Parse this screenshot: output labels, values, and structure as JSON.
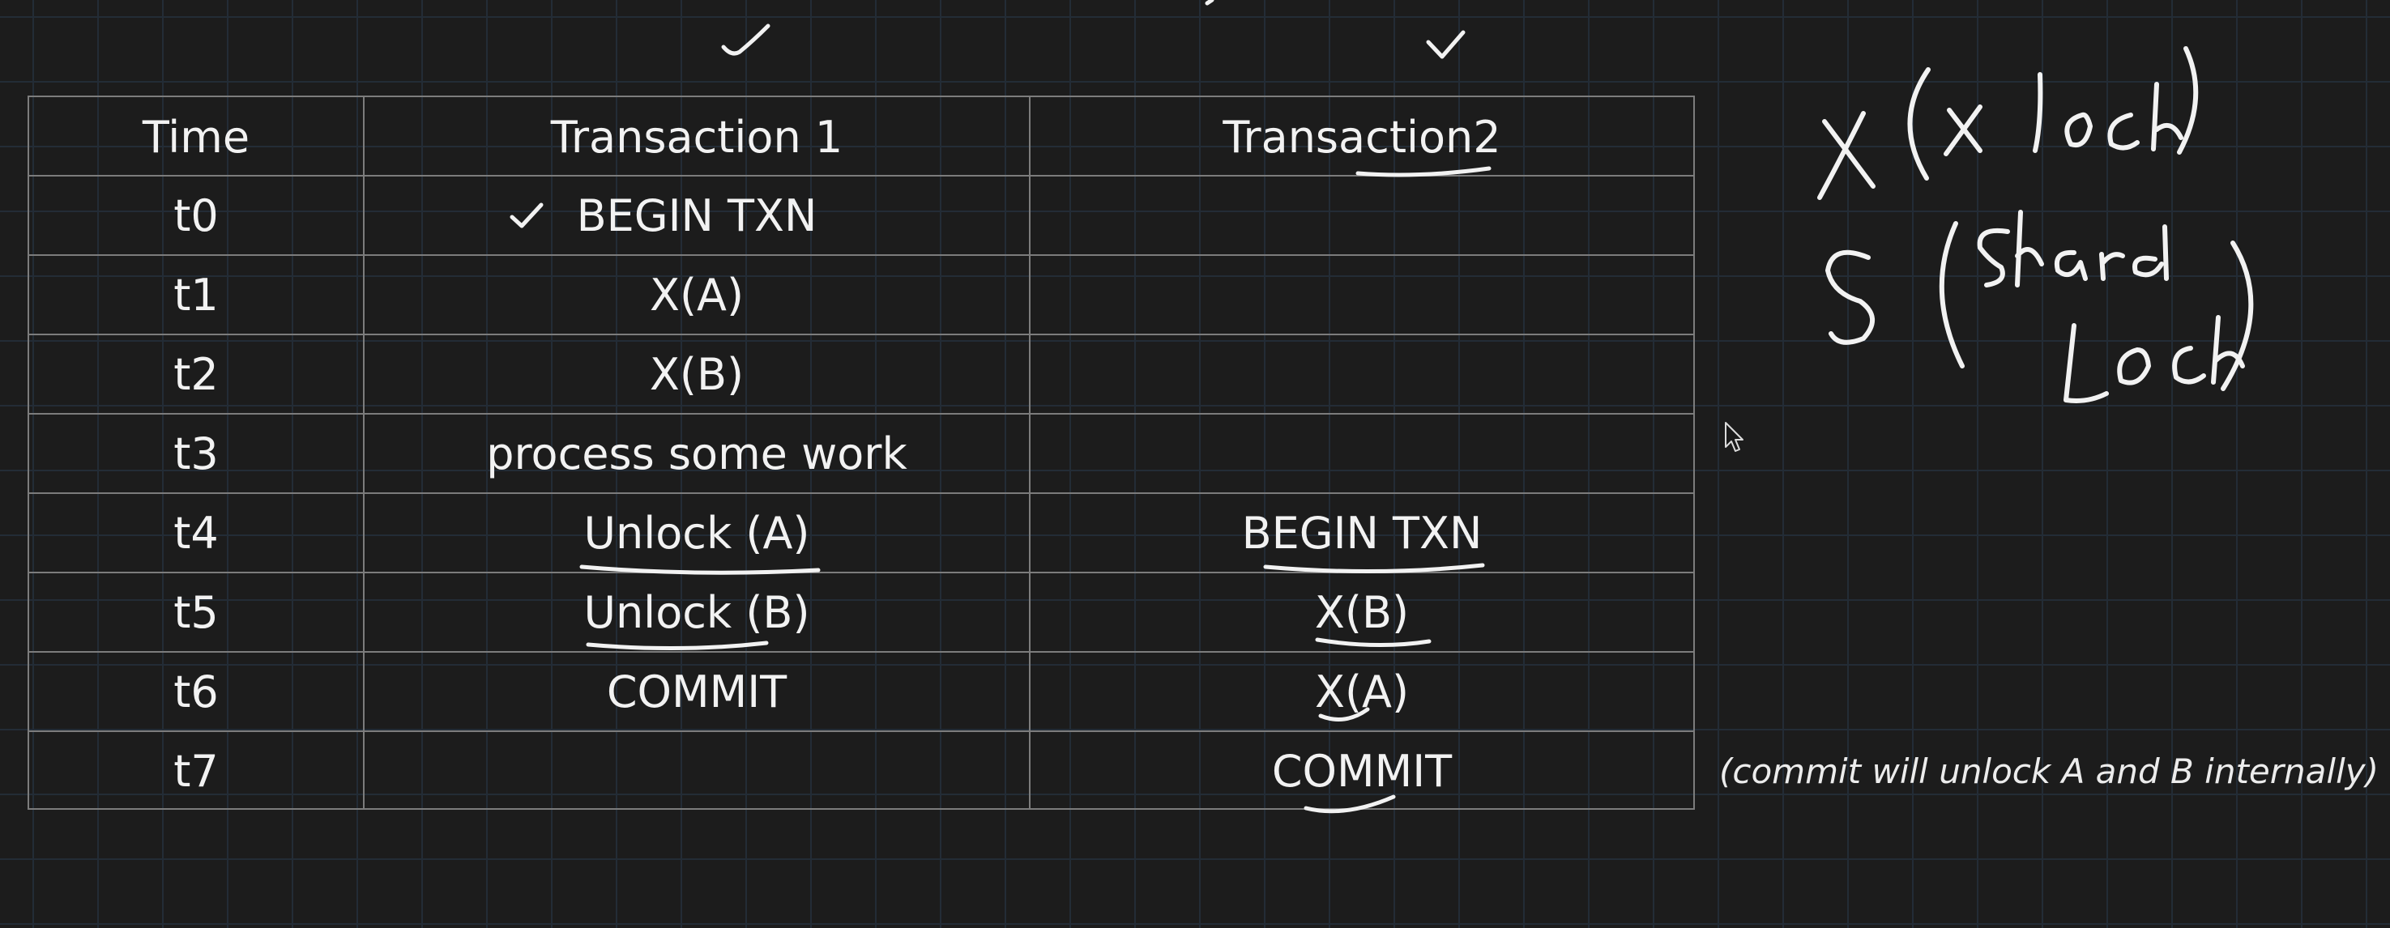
{
  "table": {
    "headers": {
      "time": "Time",
      "t1": "Transaction 1",
      "t2": "Transaction2"
    },
    "rows": [
      {
        "time": "t0",
        "t1": "BEGIN TXN",
        "t2": ""
      },
      {
        "time": "t1",
        "t1": "X(A)",
        "t2": ""
      },
      {
        "time": "t2",
        "t1": "X(B)",
        "t2": ""
      },
      {
        "time": "t3",
        "t1": "process some work",
        "t2": ""
      },
      {
        "time": "t4",
        "t1": "Unlock (A)",
        "t2": "BEGIN TXN"
      },
      {
        "time": "t5",
        "t1": "Unlock (B)",
        "t2": "X(B)"
      },
      {
        "time": "t6",
        "t1": "COMMIT",
        "t2": "X(A)"
      },
      {
        "time": "t7",
        "t1": "",
        "t2": "COMMIT"
      }
    ]
  },
  "note": "(commit will unlock A and B internally)",
  "handwriting": {
    "line1": "X(X lock)",
    "line2": "S(Shared Lock)"
  },
  "colors": {
    "background": "#1c1c1c",
    "grid": "#232c36",
    "table_border": "#7c7c7c",
    "text": "#f2f2f2",
    "ink": "#f2f2f2"
  }
}
